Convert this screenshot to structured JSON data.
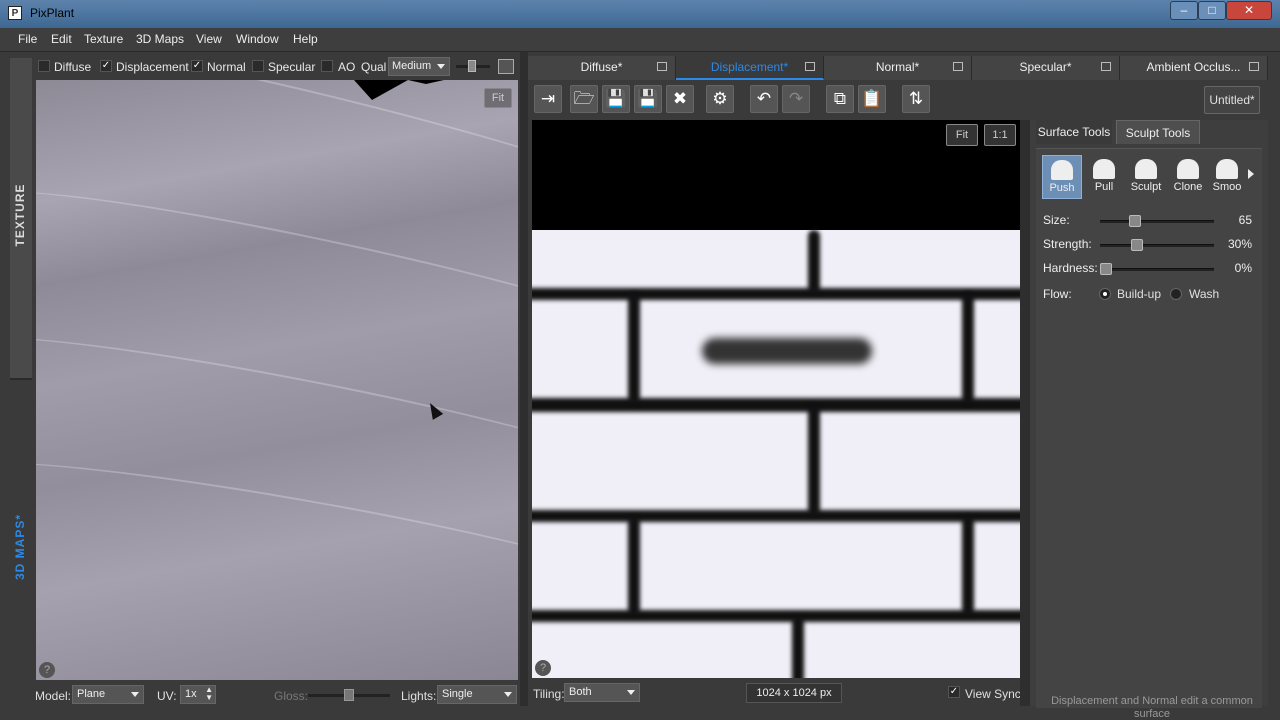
{
  "window": {
    "title": "PixPlant",
    "icon": "P",
    "controls": [
      "minimize-icon",
      "maximize-icon",
      "close-icon"
    ]
  },
  "menu": [
    "File",
    "Edit",
    "Texture",
    "3D Maps",
    "View",
    "Window",
    "Help"
  ],
  "side_tabs": {
    "texture": "TEXTURE",
    "maps": "3D MAPS*"
  },
  "preview": {
    "layers": [
      {
        "label": "Diffuse",
        "checked": false
      },
      {
        "label": "Displacement",
        "checked": true
      },
      {
        "label": "Normal",
        "checked": true
      },
      {
        "label": "Specular",
        "checked": false
      },
      {
        "label": "AO",
        "checked": false
      }
    ],
    "qual_label": "Qual",
    "quality": "Medium",
    "fit": "Fit",
    "model_label": "Model:",
    "model": "Plane",
    "uv_label": "UV:",
    "uv": "1x",
    "gloss_label": "Gloss:",
    "lights_label": "Lights:",
    "lights": "Single",
    "help": "?"
  },
  "map_tabs": [
    {
      "label": "Diffuse*",
      "active": false
    },
    {
      "label": "Displacement*",
      "active": true
    },
    {
      "label": "Normal*",
      "active": false
    },
    {
      "label": "Specular*",
      "active": false
    },
    {
      "label": "Ambient Occlus...",
      "active": false
    }
  ],
  "toolbar": {
    "icons": [
      "import-icon",
      "open-icon",
      "save-icon",
      "save-as-icon",
      "delete-icon",
      "settings-icon",
      "undo-icon",
      "redo-icon",
      "copy-icon",
      "paste-icon",
      "swap-icon"
    ],
    "document": "Untitled*"
  },
  "canvas": {
    "fit": "Fit",
    "one_to_one": "1:1",
    "tiling_label": "Tiling:",
    "tiling": "Both",
    "dims": "1024 x 1024 px",
    "view_sync": "View Sync",
    "view_sync_checked": true,
    "help": "?"
  },
  "right_panel": {
    "tabs": [
      {
        "label": "Surface Tools",
        "active": false
      },
      {
        "label": "Sculpt Tools",
        "active": true
      }
    ],
    "tools": [
      {
        "label": "Push",
        "active": true
      },
      {
        "label": "Pull",
        "active": false
      },
      {
        "label": "Sculpt",
        "active": false
      },
      {
        "label": "Clone",
        "active": false
      },
      {
        "label": "Smoo",
        "active": false
      }
    ],
    "sliders": [
      {
        "label": "Size:",
        "value": "65",
        "level": 0.28
      },
      {
        "label": "Strength:",
        "value": "30%",
        "level": 0.3
      },
      {
        "label": "Hardness:",
        "value": "0%",
        "level": 0.0
      }
    ],
    "flow_label": "Flow:",
    "flow_options": [
      {
        "label": "Build-up",
        "on": true
      },
      {
        "label": "Wash",
        "on": false
      }
    ],
    "note": "Displacement and Normal edit a common surface"
  }
}
